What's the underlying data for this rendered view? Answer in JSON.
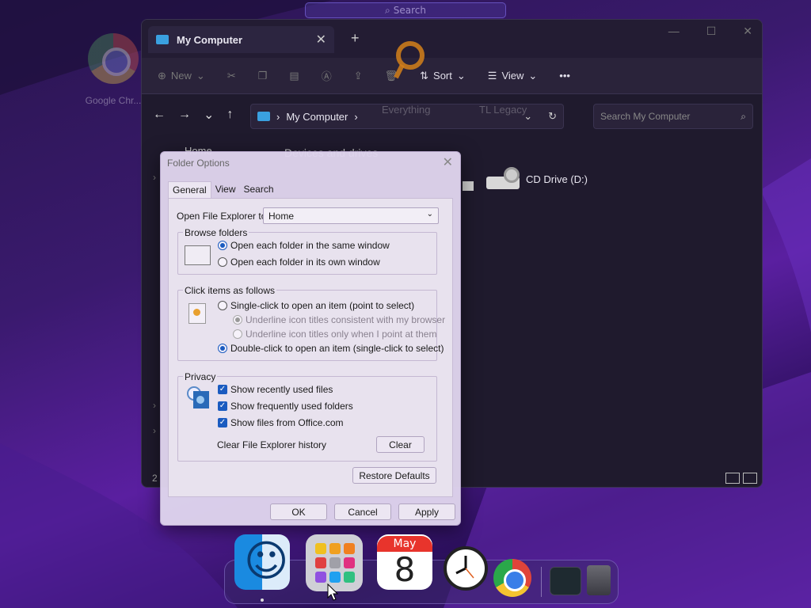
{
  "top_search": {
    "placeholder": "Search"
  },
  "desktop": {
    "chrome_label": "Google Chr..."
  },
  "explorer": {
    "tab_title": "My Computer",
    "toolbar": {
      "new": "New",
      "sort": "Sort",
      "view": "View"
    },
    "address": "My Computer",
    "search_placeholder": "Search My Computer",
    "ghost_everything": "Everything",
    "ghost_tl": "TL Legacy",
    "sidebar_home": "Home",
    "section_title": "Devices and drives",
    "cd_drive": "CD Drive (D:)",
    "item_count": "2"
  },
  "dialog": {
    "title": "Folder Options",
    "tabs": [
      "General",
      "View",
      "Search"
    ],
    "open_explorer_label": "Open File Explorer to:",
    "open_explorer_value": "Home",
    "browse": {
      "title": "Browse folders",
      "same_window": "Open each folder in the same window",
      "own_window": "Open each folder in its own window"
    },
    "click": {
      "title": "Click items as follows",
      "single": "Single-click to open an item (point to select)",
      "underline_browser": "Underline icon titles consistent with my browser",
      "underline_point": "Underline icon titles only when I point at them",
      "double": "Double-click to open an item (single-click to select)"
    },
    "privacy": {
      "title": "Privacy",
      "recent": "Show recently used files",
      "frequent": "Show frequently used folders",
      "office": "Show files from Office.com",
      "clear_label": "Clear File Explorer history",
      "clear_button": "Clear"
    },
    "restore_defaults": "Restore Defaults",
    "ok": "OK",
    "cancel": "Cancel",
    "apply": "Apply"
  },
  "dock": {
    "calendar_month": "May",
    "calendar_day": "8"
  }
}
